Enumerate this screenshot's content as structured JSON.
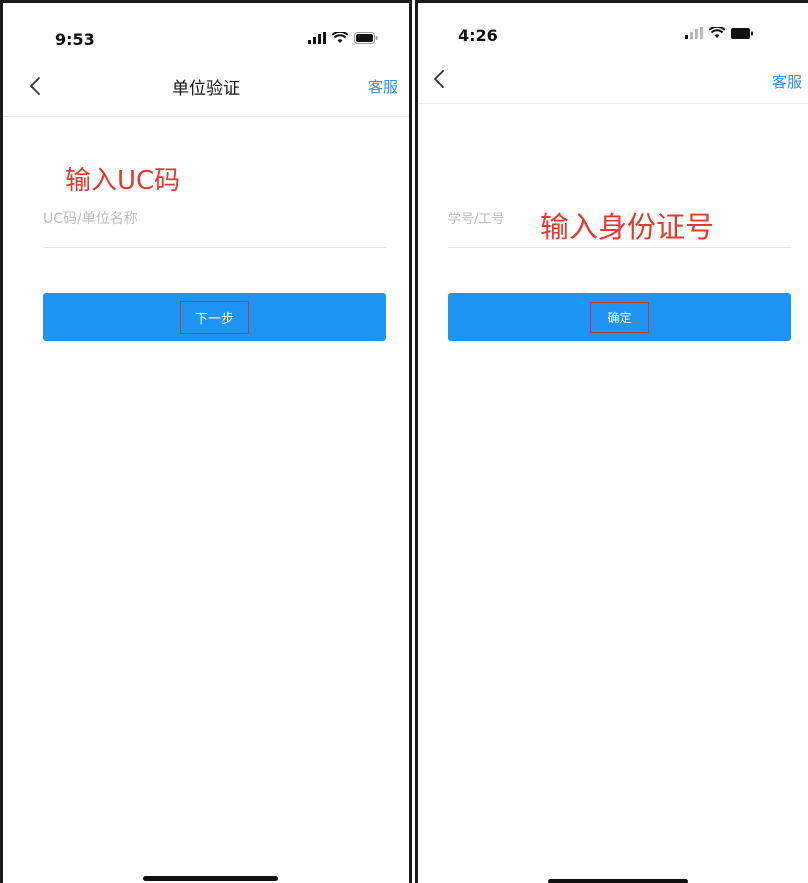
{
  "left_screen": {
    "status": {
      "time": "9:53"
    },
    "nav": {
      "title": "单位验证",
      "service_label": "客服"
    },
    "annotation": "输入UC码",
    "uc_input": {
      "placeholder": "UC码/单位名称",
      "value": ""
    },
    "next_button": {
      "label": "下一步"
    }
  },
  "right_screen": {
    "status": {
      "time": "4:26"
    },
    "nav": {
      "service_label": "客服"
    },
    "annotation": "输入身份证号",
    "id_input": {
      "placeholder": "学号/工号",
      "value": ""
    },
    "confirm_button": {
      "label": "确定"
    }
  },
  "colors": {
    "accent": "#1e95f5",
    "link": "#2e8ee8",
    "annotation_red": "#e23a2e"
  }
}
